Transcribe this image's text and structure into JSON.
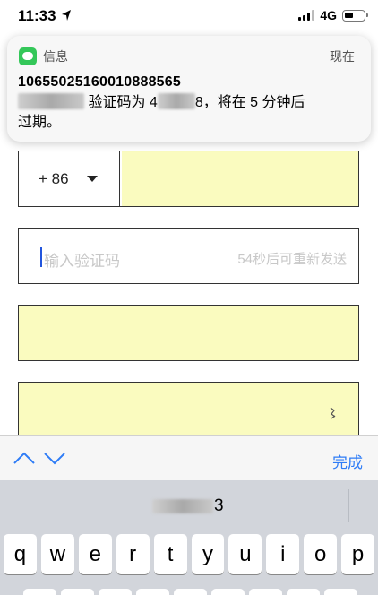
{
  "status_bar": {
    "time": "11:33",
    "network": "4G"
  },
  "notification": {
    "app_name": "信息",
    "time": "现在",
    "sender": "10655025160010888565",
    "body_part1": "验证码为 4",
    "body_part2": "8，将在 5 分钟后",
    "body_line2": "过期。"
  },
  "form": {
    "country_code": "+ 86",
    "code_placeholder": "输入验证码",
    "resend_text": "54秒后可重新发送"
  },
  "accessory_bar": {
    "done_label": "完成"
  },
  "keyboard": {
    "suggestion_suffix": "3",
    "row1": [
      "q",
      "w",
      "e",
      "r",
      "t",
      "y",
      "u",
      "i",
      "o",
      "p"
    ]
  },
  "colors": {
    "autofill_yellow": "#fafbbf",
    "accent_blue": "#2e7cf6",
    "message_green": "#34c759"
  }
}
